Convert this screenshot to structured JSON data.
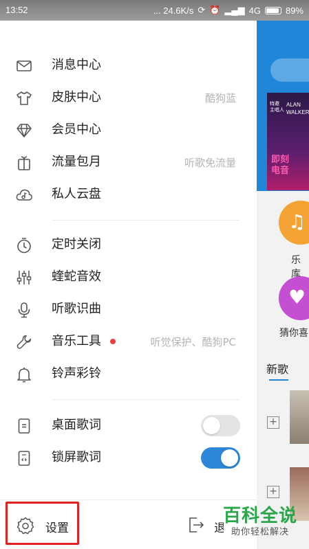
{
  "status_bar": {
    "time": "13:52",
    "net_speed": "... 24.6K/s",
    "signal": "4G",
    "battery": "89%"
  },
  "menu": {
    "group1": [
      {
        "label": "消息中心",
        "icon": "mail-icon",
        "sub": ""
      },
      {
        "label": "皮肤中心",
        "icon": "tshirt-icon",
        "sub": "酷狗蓝"
      },
      {
        "label": "会员中心",
        "icon": "diamond-icon",
        "sub": ""
      },
      {
        "label": "流量包月",
        "icon": "gift-icon",
        "sub": "听歌免流量"
      },
      {
        "label": "私人云盘",
        "icon": "cloud-music-icon",
        "sub": ""
      }
    ],
    "group2": [
      {
        "label": "定时关闭",
        "icon": "timer-icon",
        "sub": ""
      },
      {
        "label": "蝰蛇音效",
        "icon": "equalizer-icon",
        "sub": ""
      },
      {
        "label": "听歌识曲",
        "icon": "mic-icon",
        "sub": ""
      },
      {
        "label": "音乐工具",
        "icon": "wrench-icon",
        "sub": "听觉保护、酷狗PC",
        "badge": true
      },
      {
        "label": "铃声彩铃",
        "icon": "bell-icon",
        "sub": ""
      }
    ],
    "group3": [
      {
        "label": "桌面歌词",
        "icon": "desktop-lyrics-icon",
        "toggle": false
      },
      {
        "label": "锁屏歌词",
        "icon": "lockscreen-lyrics-icon",
        "toggle": true
      }
    ]
  },
  "footer": {
    "settings_label": "设置",
    "exit_label": "退出"
  },
  "background": {
    "banner_text_1": "特邀\n主唱人",
    "banner_text_2": "ALAN\nWALKER",
    "banner_text_3": "即刻\n电音",
    "tile1_label": "乐库",
    "tile2_label": "猜你喜",
    "new_songs": "新歌"
  },
  "watermark": {
    "title": "百科全说",
    "subtitle": "助你轻松解决"
  },
  "colors": {
    "accent": "#2d86d8",
    "badge": "#f03e3e",
    "highlight": "#e32020"
  }
}
